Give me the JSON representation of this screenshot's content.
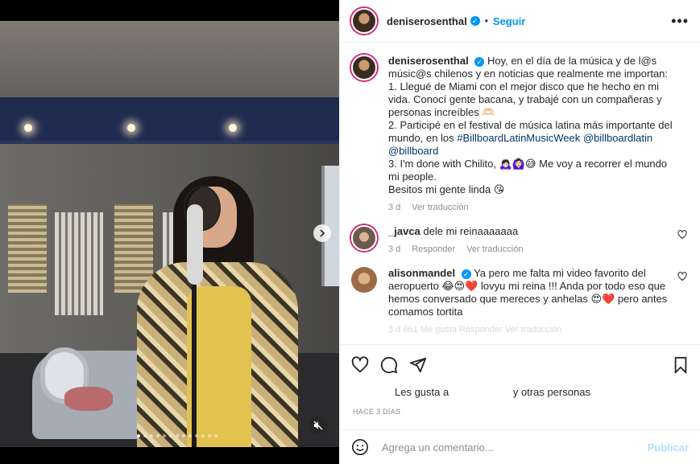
{
  "post": {
    "username": "deniserosenthal",
    "follow_label": "Seguir",
    "separator": "•"
  },
  "caption": {
    "username": "deniserosenthal",
    "lines": [
      "Hoy, en el día de la música y de l@s músic@s chilenos y en noticias que realmente me importan:",
      "1. Llegué de Miami con el mejor disco que he hecho en mi vida. Conocí gente bacana, y trabajé con un compañeras y personas increíbles 🫶🏻",
      "2. Participé en el festival de música latina más importante del mundo, en los",
      "3. I'm done with Chilito, 🙇🏻‍♀️🙆🏻‍♀️😅 Me voy a recorrer el mundo mi people.",
      "Besitos mi gente linda 😘"
    ],
    "tags": [
      "#BillboardLatinMusicWeek",
      "@billboardlatin",
      "@billboard"
    ],
    "time": "3 d",
    "translate": "Ver traducción"
  },
  "comments": [
    {
      "username": "_javca",
      "text": "dele mi reinaaaaaaa",
      "time": "3 d",
      "reply": "Responder",
      "translate": "Ver traducción"
    },
    {
      "username": "alisonmandel",
      "text": "Ya pero me falta mi video favorito del aeropuerto 😂😍❤️ lovyu mi reina !!! Anda por todo eso que hemos conversado que mereces y anhelas 😍❤️ pero antes comamos tortita",
      "meta_partial": "3 d   661 Me gusta   Responder   Ver traducción"
    }
  ],
  "actions": {
    "likes_prefix": "Les gusta a",
    "likes_suffix": "y otras personas",
    "date": "HACE 3 DÍAS",
    "comment_placeholder": "Agrega un comentario...",
    "publish": "Publicar"
  },
  "icons": {
    "more": "more-options-icon",
    "heart": "heart-icon",
    "comment": "comment-icon",
    "share": "share-icon",
    "bookmark": "bookmark-icon",
    "emoji": "emoji-icon",
    "next": "chevron-right-icon",
    "mute": "muted-speaker-icon"
  },
  "colors": {
    "accent": "#0095f6",
    "tag": "#00376b",
    "muted": "#8e8e8e"
  }
}
